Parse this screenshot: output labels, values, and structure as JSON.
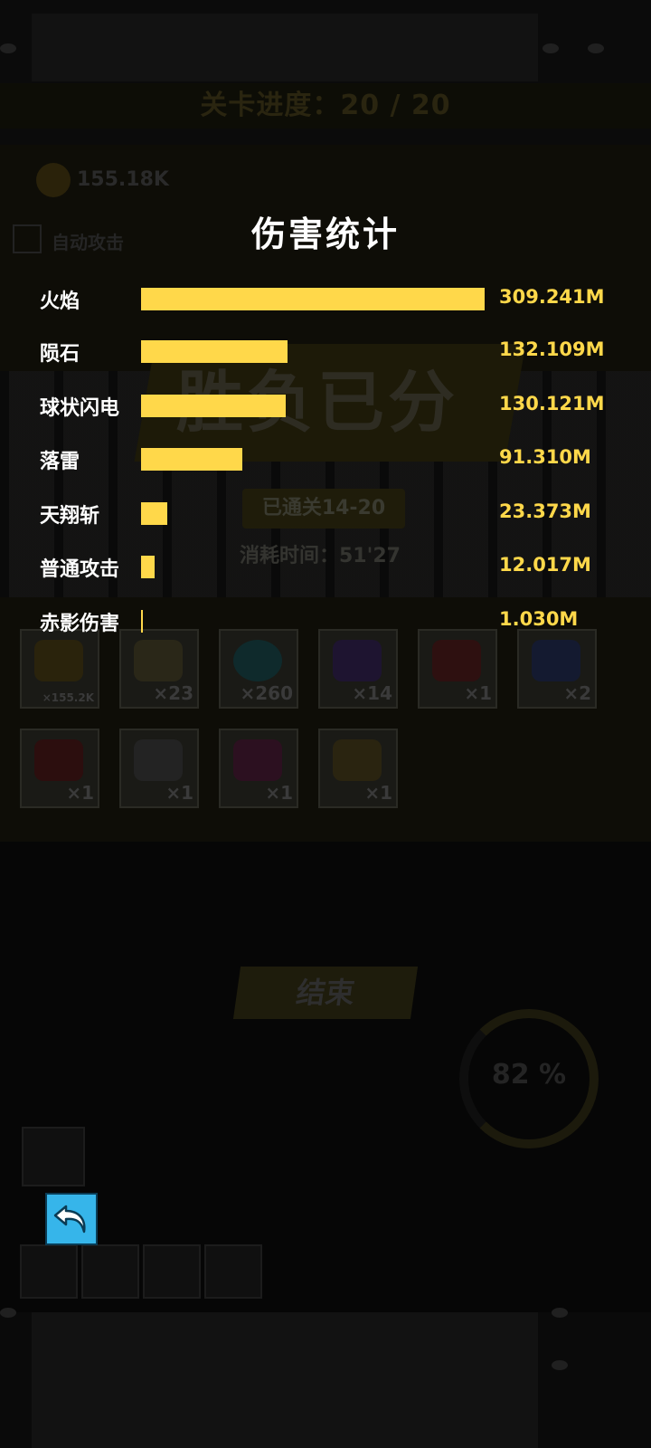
{
  "overlay": {
    "title": "伤害统计",
    "rows": [
      {
        "label": "火焰",
        "value": "309.241M",
        "fraction": 1.0
      },
      {
        "label": "陨石",
        "value": "132.109M",
        "fraction": 0.427
      },
      {
        "label": "球状闪电",
        "value": "130.121M",
        "fraction": 0.421
      },
      {
        "label": "落雷",
        "value": "91.310M",
        "fraction": 0.295
      },
      {
        "label": "天翔斩",
        "value": "23.373M",
        "fraction": 0.0756
      },
      {
        "label": "普通攻击",
        "value": "12.017M",
        "fraction": 0.0389
      },
      {
        "label": "赤影伤害",
        "value": "1.030M",
        "fraction": 0.0033
      }
    ],
    "bar_color": "#ffd84a",
    "back_icon": "undo-arrow-icon"
  },
  "background": {
    "stage_progress": "关卡进度：20 / 20",
    "coins": "155.18K",
    "auto_attack_label": "自动攻击",
    "banner_text": "胜负已分",
    "cleared_text": "已通关14-20",
    "time_text": "消耗时间：51'27",
    "rewards": [
      "×155.2K",
      "×23",
      "×260",
      "×14",
      "×1",
      "×2",
      "×1",
      "×1",
      "×1",
      "×1"
    ],
    "end_button": "结束",
    "percent": "82 %"
  }
}
